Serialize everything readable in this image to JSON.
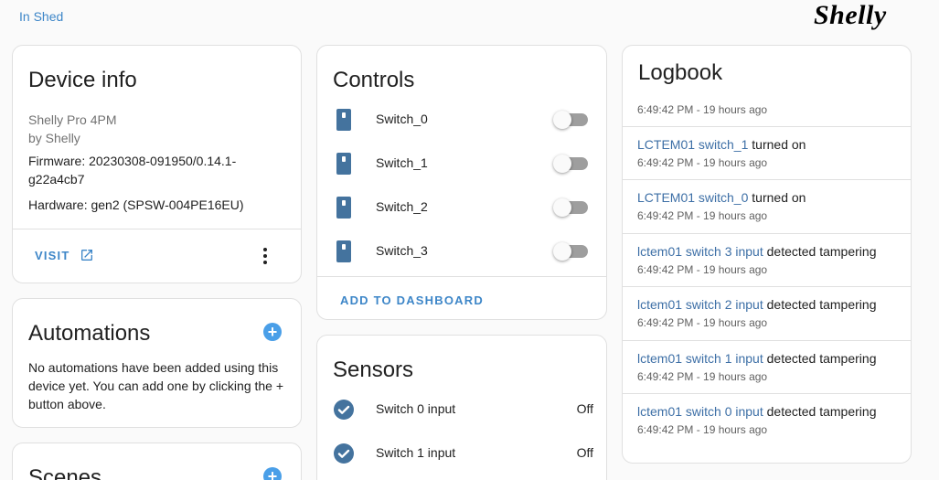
{
  "header": {
    "area_link": "In Shed",
    "brand": "Shelly"
  },
  "device_info": {
    "title": "Device info",
    "model": "Shelly Pro 4PM",
    "manufacturer": "by Shelly",
    "firmware_line1": "Firmware: 20230308-091950/0.14.1-",
    "firmware_line2": "g22a4cb7",
    "hardware": "Hardware: gen2 (SPSW-004PE16EU)",
    "visit_label": "VISIT"
  },
  "automations": {
    "title": "Automations",
    "empty_text": "No automations have been added using this device yet. You can add one by clicking the + button above."
  },
  "scenes": {
    "title": "Scenes"
  },
  "controls": {
    "title": "Controls",
    "items": [
      {
        "label": "Switch_0",
        "on": false
      },
      {
        "label": "Switch_1",
        "on": false
      },
      {
        "label": "Switch_2",
        "on": false
      },
      {
        "label": "Switch_3",
        "on": false
      }
    ],
    "add_label": "ADD TO DASHBOARD"
  },
  "sensors": {
    "title": "Sensors",
    "items": [
      {
        "label": "Switch 0 input",
        "state": "Off"
      },
      {
        "label": "Switch 1 input",
        "state": "Off"
      }
    ]
  },
  "logbook": {
    "title": "Logbook",
    "first_time": "6:49:42 PM - 19 hours ago",
    "entries": [
      {
        "link": "LCTEM01 switch_1",
        "action": " turned on",
        "time": "6:49:42 PM - 19 hours ago"
      },
      {
        "link": "LCTEM01 switch_0",
        "action": " turned on",
        "time": "6:49:42 PM - 19 hours ago"
      },
      {
        "link": "lctem01 switch 3 input",
        "action": " detected tampering",
        "time": "6:49:42 PM - 19 hours ago"
      },
      {
        "link": "lctem01 switch 2 input",
        "action": " detected tampering",
        "time": "6:49:42 PM - 19 hours ago"
      },
      {
        "link": "lctem01 switch 1 input",
        "action": " detected tampering",
        "time": "6:49:42 PM - 19 hours ago"
      },
      {
        "link": "lctem01 switch 0 input",
        "action": " detected tampering",
        "time": "6:49:42 PM - 19 hours ago"
      }
    ]
  },
  "colors": {
    "accent": "#3d86c8",
    "icon": "#44739e",
    "brand": "#4a78ba"
  }
}
